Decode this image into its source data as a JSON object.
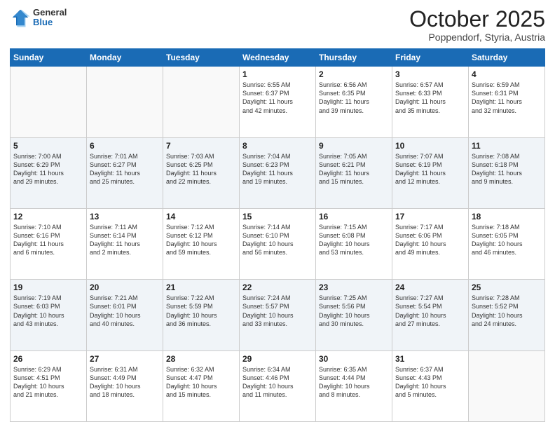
{
  "header": {
    "logo": {
      "general": "General",
      "blue": "Blue"
    },
    "month": "October 2025",
    "location": "Poppendorf, Styria, Austria"
  },
  "weekdays": [
    "Sunday",
    "Monday",
    "Tuesday",
    "Wednesday",
    "Thursday",
    "Friday",
    "Saturday"
  ],
  "weeks": [
    [
      {
        "day": "",
        "info": ""
      },
      {
        "day": "",
        "info": ""
      },
      {
        "day": "",
        "info": ""
      },
      {
        "day": "1",
        "info": "Sunrise: 6:55 AM\nSunset: 6:37 PM\nDaylight: 11 hours\nand 42 minutes."
      },
      {
        "day": "2",
        "info": "Sunrise: 6:56 AM\nSunset: 6:35 PM\nDaylight: 11 hours\nand 39 minutes."
      },
      {
        "day": "3",
        "info": "Sunrise: 6:57 AM\nSunset: 6:33 PM\nDaylight: 11 hours\nand 35 minutes."
      },
      {
        "day": "4",
        "info": "Sunrise: 6:59 AM\nSunset: 6:31 PM\nDaylight: 11 hours\nand 32 minutes."
      }
    ],
    [
      {
        "day": "5",
        "info": "Sunrise: 7:00 AM\nSunset: 6:29 PM\nDaylight: 11 hours\nand 29 minutes."
      },
      {
        "day": "6",
        "info": "Sunrise: 7:01 AM\nSunset: 6:27 PM\nDaylight: 11 hours\nand 25 minutes."
      },
      {
        "day": "7",
        "info": "Sunrise: 7:03 AM\nSunset: 6:25 PM\nDaylight: 11 hours\nand 22 minutes."
      },
      {
        "day": "8",
        "info": "Sunrise: 7:04 AM\nSunset: 6:23 PM\nDaylight: 11 hours\nand 19 minutes."
      },
      {
        "day": "9",
        "info": "Sunrise: 7:05 AM\nSunset: 6:21 PM\nDaylight: 11 hours\nand 15 minutes."
      },
      {
        "day": "10",
        "info": "Sunrise: 7:07 AM\nSunset: 6:19 PM\nDaylight: 11 hours\nand 12 minutes."
      },
      {
        "day": "11",
        "info": "Sunrise: 7:08 AM\nSunset: 6:18 PM\nDaylight: 11 hours\nand 9 minutes."
      }
    ],
    [
      {
        "day": "12",
        "info": "Sunrise: 7:10 AM\nSunset: 6:16 PM\nDaylight: 11 hours\nand 6 minutes."
      },
      {
        "day": "13",
        "info": "Sunrise: 7:11 AM\nSunset: 6:14 PM\nDaylight: 11 hours\nand 2 minutes."
      },
      {
        "day": "14",
        "info": "Sunrise: 7:12 AM\nSunset: 6:12 PM\nDaylight: 10 hours\nand 59 minutes."
      },
      {
        "day": "15",
        "info": "Sunrise: 7:14 AM\nSunset: 6:10 PM\nDaylight: 10 hours\nand 56 minutes."
      },
      {
        "day": "16",
        "info": "Sunrise: 7:15 AM\nSunset: 6:08 PM\nDaylight: 10 hours\nand 53 minutes."
      },
      {
        "day": "17",
        "info": "Sunrise: 7:17 AM\nSunset: 6:06 PM\nDaylight: 10 hours\nand 49 minutes."
      },
      {
        "day": "18",
        "info": "Sunrise: 7:18 AM\nSunset: 6:05 PM\nDaylight: 10 hours\nand 46 minutes."
      }
    ],
    [
      {
        "day": "19",
        "info": "Sunrise: 7:19 AM\nSunset: 6:03 PM\nDaylight: 10 hours\nand 43 minutes."
      },
      {
        "day": "20",
        "info": "Sunrise: 7:21 AM\nSunset: 6:01 PM\nDaylight: 10 hours\nand 40 minutes."
      },
      {
        "day": "21",
        "info": "Sunrise: 7:22 AM\nSunset: 5:59 PM\nDaylight: 10 hours\nand 36 minutes."
      },
      {
        "day": "22",
        "info": "Sunrise: 7:24 AM\nSunset: 5:57 PM\nDaylight: 10 hours\nand 33 minutes."
      },
      {
        "day": "23",
        "info": "Sunrise: 7:25 AM\nSunset: 5:56 PM\nDaylight: 10 hours\nand 30 minutes."
      },
      {
        "day": "24",
        "info": "Sunrise: 7:27 AM\nSunset: 5:54 PM\nDaylight: 10 hours\nand 27 minutes."
      },
      {
        "day": "25",
        "info": "Sunrise: 7:28 AM\nSunset: 5:52 PM\nDaylight: 10 hours\nand 24 minutes."
      }
    ],
    [
      {
        "day": "26",
        "info": "Sunrise: 6:29 AM\nSunset: 4:51 PM\nDaylight: 10 hours\nand 21 minutes."
      },
      {
        "day": "27",
        "info": "Sunrise: 6:31 AM\nSunset: 4:49 PM\nDaylight: 10 hours\nand 18 minutes."
      },
      {
        "day": "28",
        "info": "Sunrise: 6:32 AM\nSunset: 4:47 PM\nDaylight: 10 hours\nand 15 minutes."
      },
      {
        "day": "29",
        "info": "Sunrise: 6:34 AM\nSunset: 4:46 PM\nDaylight: 10 hours\nand 11 minutes."
      },
      {
        "day": "30",
        "info": "Sunrise: 6:35 AM\nSunset: 4:44 PM\nDaylight: 10 hours\nand 8 minutes."
      },
      {
        "day": "31",
        "info": "Sunrise: 6:37 AM\nSunset: 4:43 PM\nDaylight: 10 hours\nand 5 minutes."
      },
      {
        "day": "",
        "info": ""
      }
    ]
  ]
}
